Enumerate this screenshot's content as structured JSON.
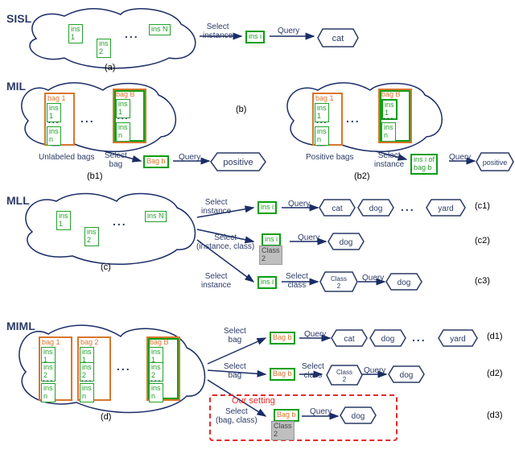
{
  "titles": {
    "sisl": "SISL",
    "mil": "MIL",
    "mll": "MLL",
    "miml": "MIML"
  },
  "labels": {
    "select_instance": "Select\ninstance",
    "select_bag": "Select\nbag",
    "select_class": "Select\nclass",
    "select_inst_class": "Select\n(instance, class)",
    "select_bag_class": "Select\n(bag, class)",
    "query": "Query",
    "our": "Our setting",
    "unlabeled": "Unlabeled bags",
    "positive_bags": "Positive bags"
  },
  "caps": {
    "a": "(a)",
    "b": "(b)",
    "b1": "(b1)",
    "b2": "(b2)",
    "c": "(c)",
    "c1": "(c1)",
    "c2": "(c2)",
    "c3": "(c3)",
    "d": "(d)",
    "d1": "(d1)",
    "d2": "(d2)",
    "d3": "(d3)"
  },
  "ins": {
    "p1": "ins\n1",
    "p2": "ins\n2",
    "pn": "ins\nn",
    "pN": "ins N",
    "pi": "ins i",
    "insibag": "ins i of\nbag b"
  },
  "bags": {
    "b1": "bag 1",
    "b2": "bag 2",
    "bB": "bag B",
    "bb": "Bag b"
  },
  "classbox": {
    "c2": "Class\n2"
  },
  "outputs": {
    "cat": "cat",
    "dog": "dog",
    "yard": "yard",
    "positive": "positive"
  },
  "ell": "..."
}
